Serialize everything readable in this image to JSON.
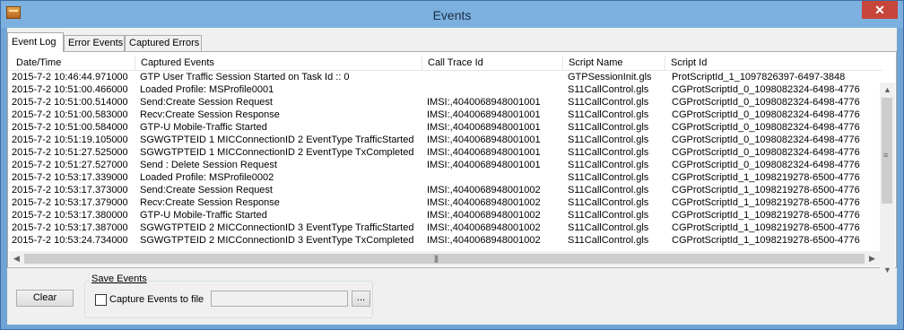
{
  "window": {
    "title": "Events",
    "close_glyph": "✕",
    "app_icon": "toolbox-icon"
  },
  "tabs": [
    {
      "label": "Event Log",
      "active": true
    },
    {
      "label": "Error Events",
      "active": false
    },
    {
      "label": "Captured Errors",
      "active": false
    }
  ],
  "table": {
    "columns": [
      "Date/Time",
      "Captured Events",
      "Call Trace Id",
      "Script Name",
      "Script Id"
    ],
    "rows": [
      [
        "2015-7-2 10:46:44.971000",
        "GTP User Traffic Session Started on Task Id :: 0",
        "",
        "GTPSessionInit.gls",
        "ProtScriptId_1_1097826397-6497-3848"
      ],
      [
        "2015-7-2 10:51:00.466000",
        "Loaded Profile: MSProfile0001",
        "",
        "S11CallControl.gls",
        "CGProtScriptId_0_1098082324-6498-4776"
      ],
      [
        "2015-7-2 10:51:00.514000",
        "Send:Create Session Request",
        "IMSI:,4040068948001001",
        "S11CallControl.gls",
        "CGProtScriptId_0_1098082324-6498-4776"
      ],
      [
        "2015-7-2 10:51:00.583000",
        "Recv:Create Session Response",
        "IMSI:,4040068948001001",
        "S11CallControl.gls",
        "CGProtScriptId_0_1098082324-6498-4776"
      ],
      [
        "2015-7-2 10:51:00.584000",
        "GTP-U Mobile-Traffic Started",
        "IMSI:,4040068948001001",
        "S11CallControl.gls",
        "CGProtScriptId_0_1098082324-6498-4776"
      ],
      [
        "2015-7-2 10:51:19.105000",
        "SGWGTPTEID 1 MICConnectionID 2 EventType TrafficStarted",
        "IMSI:,4040068948001001",
        "S11CallControl.gls",
        "CGProtScriptId_0_1098082324-6498-4776"
      ],
      [
        "2015-7-2 10:51:27.525000",
        "SGWGTPTEID 1 MICConnectionID 2 EventType TxCompleted",
        "IMSI:,4040068948001001",
        "S11CallControl.gls",
        "CGProtScriptId_0_1098082324-6498-4776"
      ],
      [
        "2015-7-2 10:51:27.527000",
        "Send : Delete Session Request",
        "IMSI:,4040068948001001",
        "S11CallControl.gls",
        "CGProtScriptId_0_1098082324-6498-4776"
      ],
      [
        "2015-7-2 10:53:17.339000",
        "Loaded Profile: MSProfile0002",
        "",
        "S11CallControl.gls",
        "CGProtScriptId_1_1098219278-6500-4776"
      ],
      [
        "2015-7-2 10:53:17.373000",
        "Send:Create Session Request",
        "IMSI:,4040068948001002",
        "S11CallControl.gls",
        "CGProtScriptId_1_1098219278-6500-4776"
      ],
      [
        "2015-7-2 10:53:17.379000",
        "Recv:Create Session Response",
        "IMSI:,4040068948001002",
        "S11CallControl.gls",
        "CGProtScriptId_1_1098219278-6500-4776"
      ],
      [
        "2015-7-2 10:53:17.380000",
        "GTP-U Mobile-Traffic Started",
        "IMSI:,4040068948001002",
        "S11CallControl.gls",
        "CGProtScriptId_1_1098219278-6500-4776"
      ],
      [
        "2015-7-2 10:53:17.387000",
        "SGWGTPTEID 2 MICConnectionID 3 EventType TrafficStarted",
        "IMSI:,4040068948001002",
        "S11CallControl.gls",
        "CGProtScriptId_1_1098219278-6500-4776"
      ],
      [
        "2015-7-2 10:53:24.734000",
        "SGWGTPTEID 2 MICConnectionID 3 EventType TxCompleted",
        "IMSI:,4040068948001002",
        "S11CallControl.gls",
        "CGProtScriptId_1_1098219278-6500-4776"
      ]
    ]
  },
  "scroll": {
    "up": "▲",
    "down": "▼",
    "left": "◀",
    "right": "▶",
    "grip_v": "≡",
    "grip_h": "|||"
  },
  "footer": {
    "clear_label": "Clear",
    "group_title": "Save Events",
    "capture_label": "Capture Events to file",
    "capture_checked": false,
    "path_value": "",
    "browse_label": "..."
  }
}
